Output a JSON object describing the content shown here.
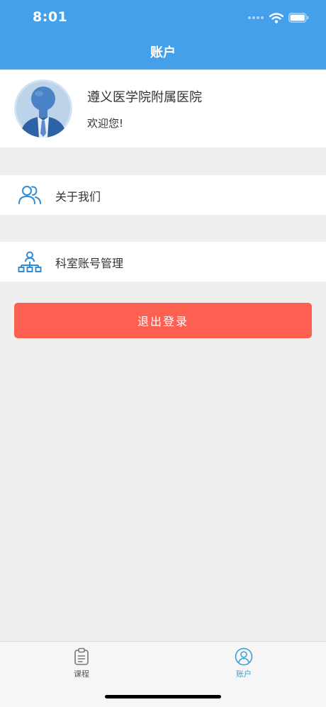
{
  "status_bar": {
    "time": "8:01"
  },
  "header": {
    "title": "账户"
  },
  "profile": {
    "name": "遵义医学院附属医院",
    "welcome": "欢迎您!"
  },
  "menu": [
    {
      "label": "关于我们",
      "icon": "people-icon"
    },
    {
      "label": "科室账号管理",
      "icon": "org-chart-icon"
    }
  ],
  "logout_label": "退出登录",
  "tabbar": {
    "tabs": [
      {
        "label": "课程",
        "icon": "clipboard-icon",
        "active": false
      },
      {
        "label": "账户",
        "icon": "user-circle-icon",
        "active": true
      }
    ]
  },
  "colors": {
    "primary": "#44a0ea",
    "danger": "#fd5f50",
    "tab_active": "#3a9fd8",
    "background": "#efefef"
  }
}
